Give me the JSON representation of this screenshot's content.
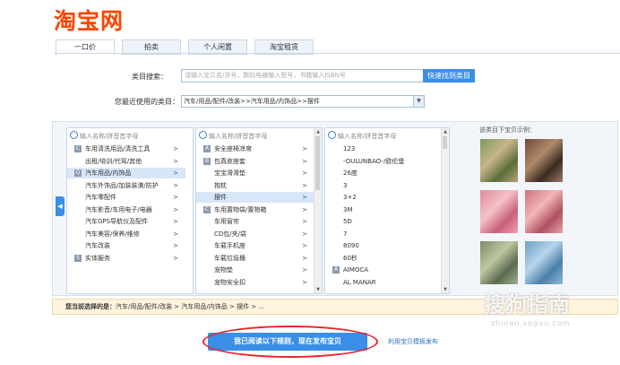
{
  "logo": "淘宝网",
  "tabs": [
    {
      "label": "一口价",
      "active": true
    },
    {
      "label": "拍卖",
      "active": false
    },
    {
      "label": "个人闲置",
      "active": false
    },
    {
      "label": "淘宝租赁",
      "active": false
    }
  ],
  "category_search": {
    "label": "类目搜索：",
    "placeholder": "请输入宝贝名/货号，数码电器输入型号，书籍输入ISBN号",
    "button": "快速找到类目"
  },
  "recent": {
    "label": "您最近使用的类目：",
    "value": "汽车/用品/配件/改装>>汽车用品/内饰品>>摆件"
  },
  "columns": {
    "search_placeholder": "输入名称/拼音首字母",
    "col1": [
      {
        "letter": "C",
        "label": "车用清洗用品/清洗工具"
      },
      {
        "letter": "",
        "label": "出租/培训/代驾/其他"
      },
      {
        "letter": "Q",
        "label": "汽车用品/内饰品",
        "selected": true
      },
      {
        "letter": "",
        "label": "汽车外饰品/加装装潢/防护"
      },
      {
        "letter": "",
        "label": "汽车零配件"
      },
      {
        "letter": "",
        "label": "汽车影音/车用电子/电器"
      },
      {
        "letter": "",
        "label": "汽车GPS导航仪及配件"
      },
      {
        "letter": "",
        "label": "汽车美容/保养/维修"
      },
      {
        "letter": "",
        "label": "汽车改装"
      },
      {
        "letter": "S",
        "label": "实体服务"
      }
    ],
    "col2": [
      {
        "letter": "A",
        "label": "安全座椅凉席"
      },
      {
        "letter": "B",
        "label": "包真皮座套"
      },
      {
        "letter": "",
        "label": "宝宝滑滑垫"
      },
      {
        "letter": "",
        "label": "抱枕"
      },
      {
        "letter": "",
        "label": "摆件",
        "selected": true
      },
      {
        "letter": "C",
        "label": "车用置物袋/置物箱"
      },
      {
        "letter": "",
        "label": "车用窗帘"
      },
      {
        "letter": "",
        "label": "CD包/夹/袋"
      },
      {
        "letter": "",
        "label": "车载手机座"
      },
      {
        "letter": "",
        "label": "车载垃圾桶"
      },
      {
        "letter": "",
        "label": "宠物垫"
      },
      {
        "letter": "",
        "label": "宠物安全扣"
      }
    ],
    "col3": [
      {
        "letter": "",
        "label": "123"
      },
      {
        "letter": "",
        "label": "-OULUNBAO-/欧伦堡"
      },
      {
        "letter": "",
        "label": "26度"
      },
      {
        "letter": "",
        "label": "3"
      },
      {
        "letter": "",
        "label": "3+2"
      },
      {
        "letter": "",
        "label": "3M"
      },
      {
        "letter": "",
        "label": "5D"
      },
      {
        "letter": "",
        "label": "7"
      },
      {
        "letter": "",
        "label": "8090"
      },
      {
        "letter": "",
        "label": "60秒"
      },
      {
        "letter": "A",
        "label": "AIMOCA"
      },
      {
        "letter": "",
        "label": "AL MANAR"
      }
    ]
  },
  "examples_title": "该类目下宝贝示例：",
  "path_bar": {
    "prefix": "您当前选择的是：",
    "path": "汽车/用品/配件/改装 > 汽车用品/内饰品 > 摆件 > ..."
  },
  "publish_button": "我已阅读以下规则，现在发布宝贝",
  "template_link": "利用宝贝模板发布",
  "watermark": "搜狗指南",
  "watermark_sub": "zhinan.sogou.com"
}
